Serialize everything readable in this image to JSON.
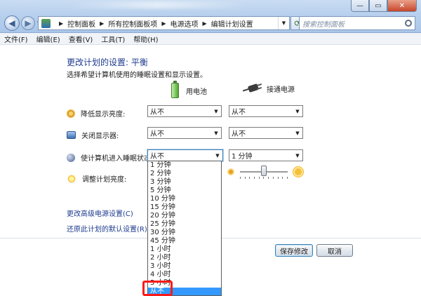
{
  "window": {
    "minimize_glyph": "—",
    "maximize_glyph": "▭",
    "close_glyph": "✕"
  },
  "breadcrumb": [
    "控制面板",
    "所有控制面板项",
    "电源选项",
    "编辑计划设置"
  ],
  "search": {
    "placeholder": "搜索控制面板"
  },
  "menu": [
    "文件(F)",
    "编辑(E)",
    "查看(V)",
    "工具(T)",
    "帮助(H)"
  ],
  "page": {
    "title": "更改计划的设置: 平衡",
    "subtitle": "选择希望计算机使用的睡眠设置和显示设置。"
  },
  "columns": {
    "battery": "用电池",
    "plugged": "接通电源"
  },
  "settings": {
    "dim": {
      "label": "降低显示亮度:",
      "battery": "从不",
      "plugged": "从不"
    },
    "display_off": {
      "label": "关闭显示器:",
      "battery": "从不",
      "plugged": "从不"
    },
    "sleep": {
      "label": "使计算机进入睡眠状态:",
      "battery": "从不",
      "plugged": "1 分钟"
    },
    "brightness": {
      "label": "调整计划亮度:",
      "plugged_level": 0.5
    }
  },
  "links": {
    "advanced": "更改高级电源设置(C)",
    "restore": "还原此计划的默认设置(R)"
  },
  "buttons": {
    "save": "保存修改",
    "cancel": "取消"
  },
  "dropdown_options": [
    "1 分钟",
    "2 分钟",
    "3 分钟",
    "5 分钟",
    "10 分钟",
    "15 分钟",
    "20 分钟",
    "25 分钟",
    "30 分钟",
    "45 分钟",
    "1 小时",
    "2 小时",
    "3 小时",
    "4 小时",
    "5 小时",
    "从不"
  ],
  "dropdown_selected": "从不",
  "colors": {
    "accent": "#1e3b8f",
    "highlight": "#3399ff",
    "annotation": "#ff1a1a"
  }
}
